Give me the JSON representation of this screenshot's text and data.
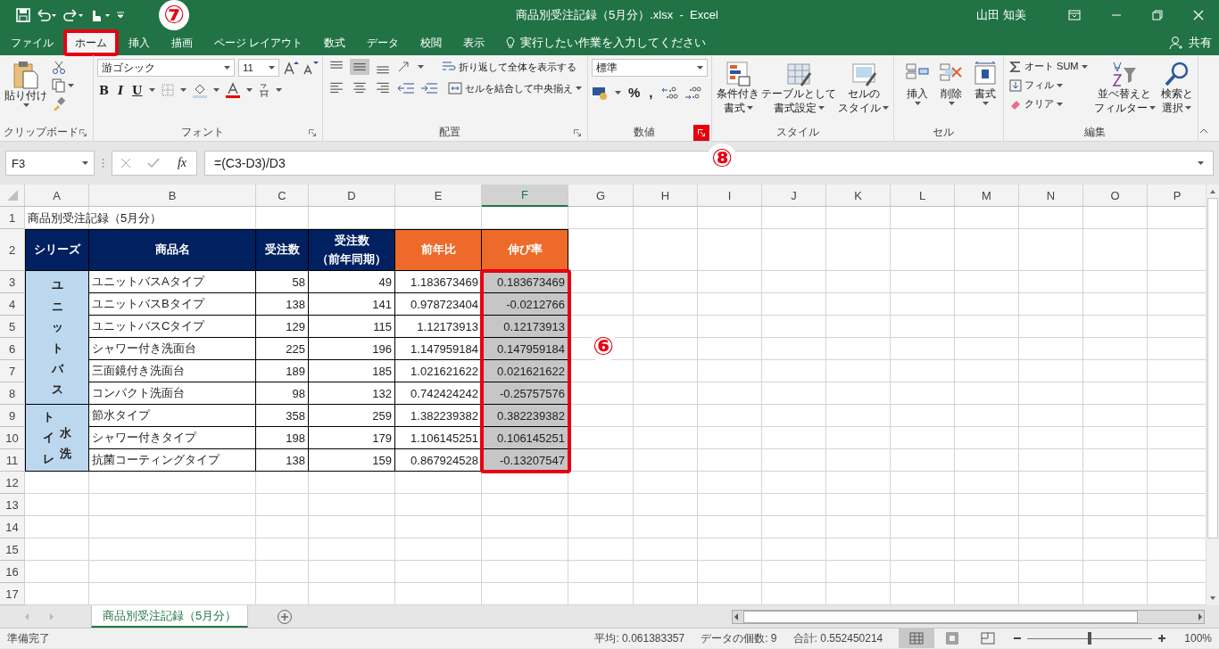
{
  "title_bar": {
    "title": "商品別受注記録（5月分）.xlsx  -  Excel",
    "user": "山田 知美"
  },
  "tabs": [
    {
      "label": "ファイル",
      "selected": false,
      "highlighted": false
    },
    {
      "label": "ホーム",
      "selected": true,
      "highlighted": true
    },
    {
      "label": "挿入",
      "selected": false,
      "highlighted": false
    },
    {
      "label": "描画",
      "selected": false,
      "highlighted": false
    },
    {
      "label": "ページ レイアウト",
      "selected": false,
      "highlighted": false
    },
    {
      "label": "数式",
      "selected": false,
      "highlighted": false
    },
    {
      "label": "データ",
      "selected": false,
      "highlighted": false
    },
    {
      "label": "校閲",
      "selected": false,
      "highlighted": false
    },
    {
      "label": "表示",
      "selected": false,
      "highlighted": false
    }
  ],
  "tell_me": {
    "placeholder": "実行したい作業を入力してください"
  },
  "share": "共有",
  "ribbon": {
    "clipboard": {
      "paste": "貼り付け",
      "label": "クリップボード"
    },
    "font": {
      "name": "游ゴシック",
      "size": "11",
      "bold": "B",
      "italic": "I",
      "underline": "U",
      "label": "フォント"
    },
    "alignment": {
      "wrap": "折り返して全体を表示する",
      "merge": "セルを結合して中央揃え",
      "label": "配置"
    },
    "number": {
      "format": "標準",
      "percent": "%",
      "comma": ",",
      "label": "数値",
      "launcher_highlighted": true
    },
    "styles": {
      "buttons": [
        {
          "lines": [
            "条件付き",
            "書式"
          ]
        },
        {
          "lines": [
            "テーブルとして",
            "書式設定"
          ]
        },
        {
          "lines": [
            "セルの",
            "スタイル"
          ]
        }
      ],
      "label": "スタイル"
    },
    "cells": {
      "buttons": [
        "挿入",
        "削除",
        "書式"
      ],
      "label": "セル"
    },
    "editing": {
      "autosum": "オート SUM",
      "fill": "フィル",
      "clear": "クリア",
      "sort": [
        "並べ替えと",
        "フィルター"
      ],
      "find": [
        "検索と",
        "選択"
      ],
      "label": "編集"
    }
  },
  "formula_bar": {
    "name_box": "F3",
    "fx": "fx",
    "formula": "=(C3-D3)/D3"
  },
  "sheet": {
    "columns": [
      {
        "label": "A",
        "selected": false
      },
      {
        "label": "B",
        "selected": false
      },
      {
        "label": "C",
        "selected": false
      },
      {
        "label": "D",
        "selected": false
      },
      {
        "label": "E",
        "selected": false
      },
      {
        "label": "F",
        "selected": true
      },
      {
        "label": "G",
        "selected": false
      },
      {
        "label": "H",
        "selected": false
      },
      {
        "label": "I",
        "selected": false
      },
      {
        "label": "J",
        "selected": false
      },
      {
        "label": "K",
        "selected": false
      },
      {
        "label": "L",
        "selected": false
      },
      {
        "label": "M",
        "selected": false
      },
      {
        "label": "N",
        "selected": false
      },
      {
        "label": "O",
        "selected": false
      },
      {
        "label": "P",
        "selected": false
      }
    ],
    "row_numbers": [
      "1",
      "2",
      "3",
      "4",
      "5",
      "6",
      "7",
      "8",
      "9",
      "10",
      "11",
      "12",
      "13",
      "14",
      "15",
      "16",
      "17"
    ],
    "title": "商品別受注記録（5月分）",
    "headers": [
      {
        "lines": [
          "シリーズ"
        ],
        "color": "#002060"
      },
      {
        "lines": [
          "商品名"
        ],
        "color": "#002060"
      },
      {
        "lines": [
          "受注数"
        ],
        "color": "#002060"
      },
      {
        "lines": [
          "受注数",
          "（前年同期）"
        ],
        "color": "#002060"
      },
      {
        "lines": [
          "前年比"
        ],
        "color": "#ee6a2b"
      },
      {
        "lines": [
          "伸び率"
        ],
        "color": "#ee6a2b"
      }
    ],
    "groups": [
      {
        "series": [
          "ユニットバス"
        ],
        "rows": [
          {
            "product": "ユニットバスAタイプ",
            "orders": "58",
            "prev": "49",
            "ratio": "1.183673469",
            "growth": "0.183673469",
            "growth_selected": true
          },
          {
            "product": "ユニットバスBタイプ",
            "orders": "138",
            "prev": "141",
            "ratio": "0.978723404",
            "growth": "-0.0212766",
            "growth_selected": true
          },
          {
            "product": "ユニットバスCタイプ",
            "orders": "129",
            "prev": "115",
            "ratio": "1.12173913",
            "growth": "0.12173913",
            "growth_selected": true
          },
          {
            "product": "シャワー付き洗面台",
            "orders": "225",
            "prev": "196",
            "ratio": "1.147959184",
            "growth": "0.147959184",
            "growth_selected": true
          },
          {
            "product": "三面鏡付き洗面台",
            "orders": "189",
            "prev": "185",
            "ratio": "1.021621622",
            "growth": "0.021621622",
            "growth_selected": true
          },
          {
            "product": "コンパクト洗面台",
            "orders": "98",
            "prev": "132",
            "ratio": "0.742424242",
            "growth": "-0.25757576",
            "growth_selected": true
          }
        ]
      },
      {
        "series": [
          "トイレ",
          "水洗"
        ],
        "rows": [
          {
            "product": "節水タイプ",
            "orders": "358",
            "prev": "259",
            "ratio": "1.382239382",
            "growth": "0.382239382",
            "growth_selected": true
          },
          {
            "product": "シャワー付きタイプ",
            "orders": "198",
            "prev": "179",
            "ratio": "1.106145251",
            "growth": "0.106145251",
            "growth_selected": true
          },
          {
            "product": "抗菌コーティングタイプ",
            "orders": "138",
            "prev": "159",
            "ratio": "0.867924528",
            "growth": "-0.13207547",
            "growth_selected": true
          }
        ]
      }
    ],
    "growth_highlighted": true
  },
  "sheet_tabs": [
    {
      "label": "商品別受注記録（5月分）",
      "selected": true
    }
  ],
  "status_bar": {
    "ready": "準備完了",
    "average": "平均: 0.061383357",
    "count": "データの個数: 9",
    "sum": "合計: 0.552450214",
    "views": [
      {
        "selected": true
      },
      {
        "selected": false
      },
      {
        "selected": false
      }
    ],
    "zoom": {
      "level": 0.5,
      "reading": "100%"
    }
  },
  "annotations": [
    {
      "kind": "tab",
      "label": "⑦"
    },
    {
      "kind": "launcher",
      "label": "⑧"
    },
    {
      "kind": "range",
      "label": "⑥"
    }
  ]
}
